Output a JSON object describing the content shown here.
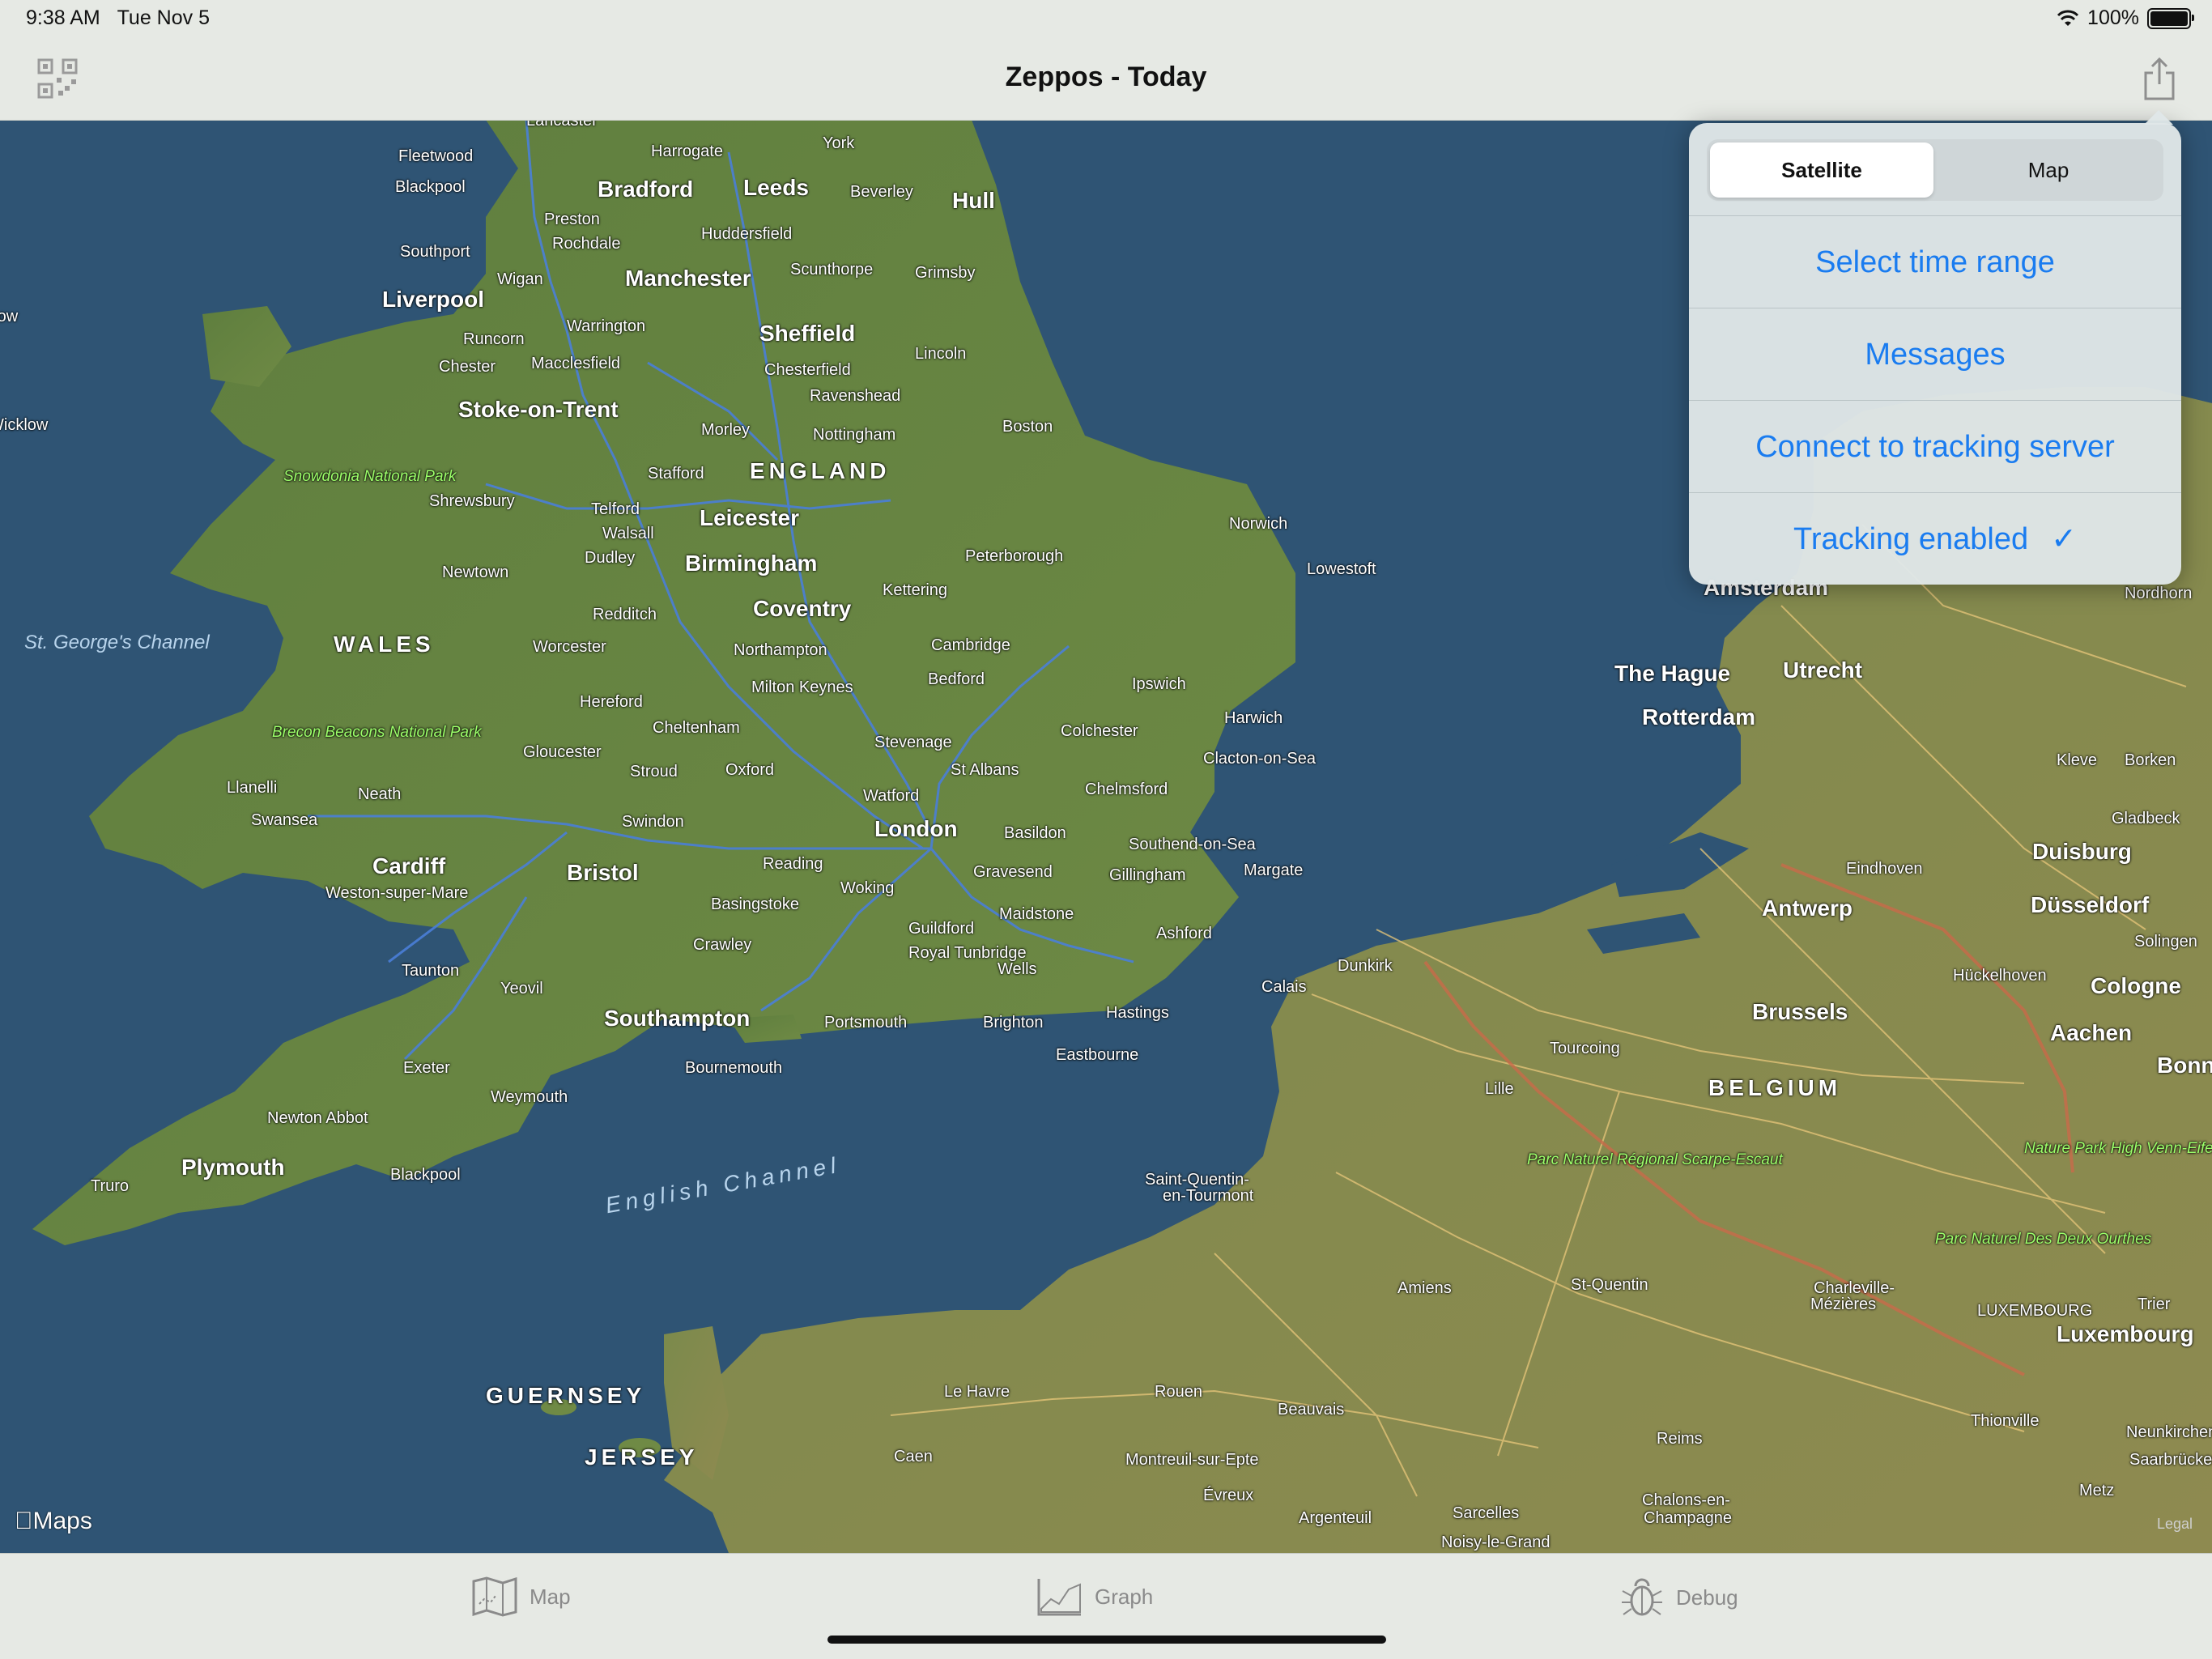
{
  "status": {
    "time": "9:38 AM",
    "date": "Tue Nov 5",
    "battery": "100%"
  },
  "nav": {
    "title": "Zeppos - Today"
  },
  "popover": {
    "segments": [
      "Satellite",
      "Map"
    ],
    "selected_segment": "Satellite",
    "items": [
      {
        "label": "Select time range"
      },
      {
        "label": "Messages"
      },
      {
        "label": "Connect to tracking server"
      },
      {
        "label": "Tracking enabled",
        "checked": true,
        "checkmark": "✓"
      }
    ]
  },
  "map": {
    "attribution": "Maps",
    "legal": "Legal",
    "labels": [
      {
        "text": "Lancaster",
        "cls": ""
      },
      {
        "text": "Harrogate",
        "cls": ""
      },
      {
        "text": "York",
        "cls": ""
      },
      {
        "text": "Fleetwood",
        "cls": ""
      },
      {
        "text": "Blackpool",
        "cls": ""
      },
      {
        "text": "Bradford",
        "cls": "big"
      },
      {
        "text": "Leeds",
        "cls": "big"
      },
      {
        "text": "Beverley",
        "cls": ""
      },
      {
        "text": "Hull",
        "cls": "big"
      },
      {
        "text": "Preston",
        "cls": ""
      },
      {
        "text": "Rochdale",
        "cls": ""
      },
      {
        "text": "Huddersfield",
        "cls": ""
      },
      {
        "text": "Southport",
        "cls": ""
      },
      {
        "text": "Wigan",
        "cls": ""
      },
      {
        "text": "Manchester",
        "cls": "big"
      },
      {
        "text": "Scunthorpe",
        "cls": ""
      },
      {
        "text": "Grimsby",
        "cls": ""
      },
      {
        "text": "Liverpool",
        "cls": "big"
      },
      {
        "text": "Warrington",
        "cls": ""
      },
      {
        "text": "Sheffield",
        "cls": "big"
      },
      {
        "text": "Runcorn",
        "cls": ""
      },
      {
        "text": "Chester",
        "cls": ""
      },
      {
        "text": "Macclesfield",
        "cls": ""
      },
      {
        "text": "Chesterfield",
        "cls": ""
      },
      {
        "text": "Lincoln",
        "cls": ""
      },
      {
        "text": "Ravenshead",
        "cls": ""
      },
      {
        "text": "Stoke-on-Trent",
        "cls": "big"
      },
      {
        "text": "Morley",
        "cls": ""
      },
      {
        "text": "Nottingham",
        "cls": ""
      },
      {
        "text": "Boston",
        "cls": ""
      },
      {
        "text": "ENGLAND",
        "cls": "country"
      },
      {
        "text": "Stafford",
        "cls": ""
      },
      {
        "text": "Shrewsbury",
        "cls": ""
      },
      {
        "text": "Telford",
        "cls": ""
      },
      {
        "text": "Leicester",
        "cls": "big"
      },
      {
        "text": "Walsall",
        "cls": ""
      },
      {
        "text": "Norwich",
        "cls": ""
      },
      {
        "text": "Dudley",
        "cls": ""
      },
      {
        "text": "Birmingham",
        "cls": "big"
      },
      {
        "text": "Peterborough",
        "cls": ""
      },
      {
        "text": "Lowestoft",
        "cls": ""
      },
      {
        "text": "Newtown",
        "cls": ""
      },
      {
        "text": "Kettering",
        "cls": ""
      },
      {
        "text": "Redditch",
        "cls": ""
      },
      {
        "text": "Coventry",
        "cls": "big"
      },
      {
        "text": "WALES",
        "cls": "country"
      },
      {
        "text": "Worcester",
        "cls": ""
      },
      {
        "text": "Northampton",
        "cls": ""
      },
      {
        "text": "Cambridge",
        "cls": ""
      },
      {
        "text": "Ipswich",
        "cls": ""
      },
      {
        "text": "Bedford",
        "cls": ""
      },
      {
        "text": "Milton Keynes",
        "cls": ""
      },
      {
        "text": "Hereford",
        "cls": ""
      },
      {
        "text": "Harwich",
        "cls": ""
      },
      {
        "text": "Cheltenham",
        "cls": ""
      },
      {
        "text": "Colchester",
        "cls": ""
      },
      {
        "text": "Gloucester",
        "cls": ""
      },
      {
        "text": "Stevenage",
        "cls": ""
      },
      {
        "text": "Stroud",
        "cls": ""
      },
      {
        "text": "Oxford",
        "cls": ""
      },
      {
        "text": "St Albans",
        "cls": ""
      },
      {
        "text": "Clacton-on-Sea",
        "cls": ""
      },
      {
        "text": "Llanelli",
        "cls": ""
      },
      {
        "text": "Neath",
        "cls": ""
      },
      {
        "text": "Watford",
        "cls": ""
      },
      {
        "text": "Chelmsford",
        "cls": ""
      },
      {
        "text": "Swansea",
        "cls": ""
      },
      {
        "text": "Swindon",
        "cls": ""
      },
      {
        "text": "London",
        "cls": "big"
      },
      {
        "text": "Basildon",
        "cls": ""
      },
      {
        "text": "Southend-on-Sea",
        "cls": ""
      },
      {
        "text": "Cardiff",
        "cls": "big"
      },
      {
        "text": "Bristol",
        "cls": "big"
      },
      {
        "text": "Reading",
        "cls": ""
      },
      {
        "text": "Gravesend",
        "cls": ""
      },
      {
        "text": "Gillingham",
        "cls": ""
      },
      {
        "text": "Margate",
        "cls": ""
      },
      {
        "text": "Weston-super-Mare",
        "cls": ""
      },
      {
        "text": "Woking",
        "cls": ""
      },
      {
        "text": "Basingstoke",
        "cls": ""
      },
      {
        "text": "Maidstone",
        "cls": ""
      },
      {
        "text": "Guildford",
        "cls": ""
      },
      {
        "text": "Ashford",
        "cls": ""
      },
      {
        "text": "Crawley",
        "cls": ""
      },
      {
        "text": "Royal Tunbridge",
        "cls": ""
      },
      {
        "text": "Wells",
        "cls": ""
      },
      {
        "text": "Taunton",
        "cls": ""
      },
      {
        "text": "Dunkirk",
        "cls": ""
      },
      {
        "text": "Yeovil",
        "cls": ""
      },
      {
        "text": "Calais",
        "cls": ""
      },
      {
        "text": "Hastings",
        "cls": ""
      },
      {
        "text": "Southampton",
        "cls": "big"
      },
      {
        "text": "Portsmouth",
        "cls": ""
      },
      {
        "text": "Brighton",
        "cls": ""
      },
      {
        "text": "Eastbourne",
        "cls": ""
      },
      {
        "text": "Exeter",
        "cls": ""
      },
      {
        "text": "Bournemouth",
        "cls": ""
      },
      {
        "text": "Weymouth",
        "cls": ""
      },
      {
        "text": "Newton Abbot",
        "cls": ""
      },
      {
        "text": "Plymouth",
        "cls": "big"
      },
      {
        "text": "Blackpool",
        "cls": ""
      },
      {
        "text": "Truro",
        "cls": ""
      },
      {
        "text": "Saint-Quentin-",
        "cls": ""
      },
      {
        "text": "en-Tourmont",
        "cls": ""
      },
      {
        "text": "GUERNSEY",
        "cls": "country"
      },
      {
        "text": "JERSEY",
        "cls": "country"
      },
      {
        "text": "Le Havre",
        "cls": ""
      },
      {
        "text": "Rouen",
        "cls": ""
      },
      {
        "text": "Beauvais",
        "cls": ""
      },
      {
        "text": "Caen",
        "cls": ""
      },
      {
        "text": "Montreuil-sur-Epte",
        "cls": ""
      },
      {
        "text": "Évreux",
        "cls": ""
      },
      {
        "text": "Argenteuil",
        "cls": ""
      },
      {
        "text": "Sarcelles",
        "cls": ""
      },
      {
        "text": "Noisy-le-Grand",
        "cls": ""
      },
      {
        "text": "Amiens",
        "cls": ""
      },
      {
        "text": "St-Quentin",
        "cls": ""
      },
      {
        "text": "Reims",
        "cls": ""
      },
      {
        "text": "Chalons-en-",
        "cls": ""
      },
      {
        "text": "Champagne",
        "cls": ""
      },
      {
        "text": "Lille",
        "cls": ""
      },
      {
        "text": "Tourcoing",
        "cls": ""
      },
      {
        "text": "Brussels",
        "cls": "big"
      },
      {
        "text": "BELGIUM",
        "cls": "country"
      },
      {
        "text": "Antwerp",
        "cls": "big"
      },
      {
        "text": "Amsterdam",
        "cls": "big"
      },
      {
        "text": "The Hague",
        "cls": "big"
      },
      {
        "text": "Utrecht",
        "cls": "big"
      },
      {
        "text": "Rotterdam",
        "cls": "big"
      },
      {
        "text": "Eindhoven",
        "cls": ""
      },
      {
        "text": "Kleve",
        "cls": ""
      },
      {
        "text": "Borken",
        "cls": ""
      },
      {
        "text": "Gladbeck",
        "cls": ""
      },
      {
        "text": "Duisburg",
        "cls": "big"
      },
      {
        "text": "Düsseldorf",
        "cls": "big"
      },
      {
        "text": "Solingen",
        "cls": ""
      },
      {
        "text": "Hückelhoven",
        "cls": ""
      },
      {
        "text": "Cologne",
        "cls": "big"
      },
      {
        "text": "Aachen",
        "cls": "big"
      },
      {
        "text": "Bonn",
        "cls": "big"
      },
      {
        "text": "Charleville-",
        "cls": ""
      },
      {
        "text": "Mézières",
        "cls": ""
      },
      {
        "text": "LUXEMBOURG",
        "cls": ""
      },
      {
        "text": "Luxembourg",
        "cls": "big"
      },
      {
        "text": "Trier",
        "cls": ""
      },
      {
        "text": "Thionville",
        "cls": ""
      },
      {
        "text": "Saarbrücken",
        "cls": ""
      },
      {
        "text": "Neunkirchen",
        "cls": ""
      },
      {
        "text": "Metz",
        "cls": ""
      },
      {
        "text": "Nordhorn",
        "cls": ""
      },
      {
        "text": "Wicklow",
        "cls": ""
      },
      {
        "text": "Carlow",
        "cls": ""
      }
    ],
    "parks": [
      "Snowdonia National Park",
      "Brecon Beacons National Park",
      "Parc Naturel Régional Scarpe-Escaut",
      "Nature Park High Venn-Eifel",
      "Parc Naturel Des Deux Ourthes"
    ],
    "seas": [
      "St. George's Channel",
      "English Channel"
    ]
  },
  "tabs": [
    {
      "label": "Map"
    },
    {
      "label": "Graph"
    },
    {
      "label": "Debug"
    }
  ]
}
